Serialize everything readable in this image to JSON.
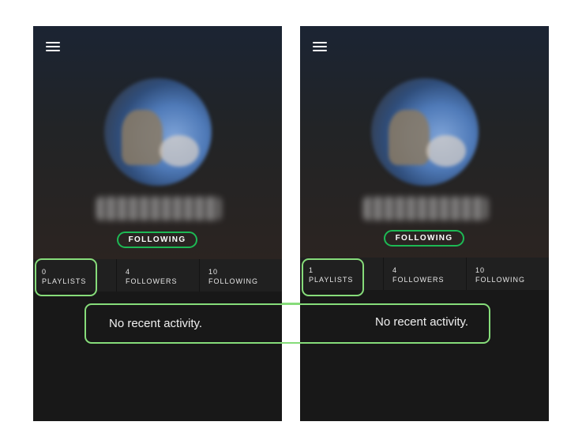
{
  "screens": [
    {
      "id": "left",
      "follow_label": "FOLLOWING",
      "stats": [
        {
          "count": "0",
          "label": "PLAYLISTS"
        },
        {
          "count": "4",
          "label": "FOLLOWERS"
        },
        {
          "count": "10",
          "label": "FOLLOWING"
        }
      ],
      "activity_text": "No recent activity."
    },
    {
      "id": "right",
      "follow_label": "FOLLOWING",
      "stats": [
        {
          "count": "1",
          "label": "PLAYLISTS"
        },
        {
          "count": "4",
          "label": "FOLLOWERS"
        },
        {
          "count": "10",
          "label": "FOLLOWING"
        }
      ],
      "activity_text": "No recent activity."
    }
  ],
  "colors": {
    "accent_green": "#1db954",
    "highlight_green": "#86dc7a",
    "background_dark": "#181818"
  },
  "icons": {
    "menu": "hamburger-menu-icon"
  }
}
